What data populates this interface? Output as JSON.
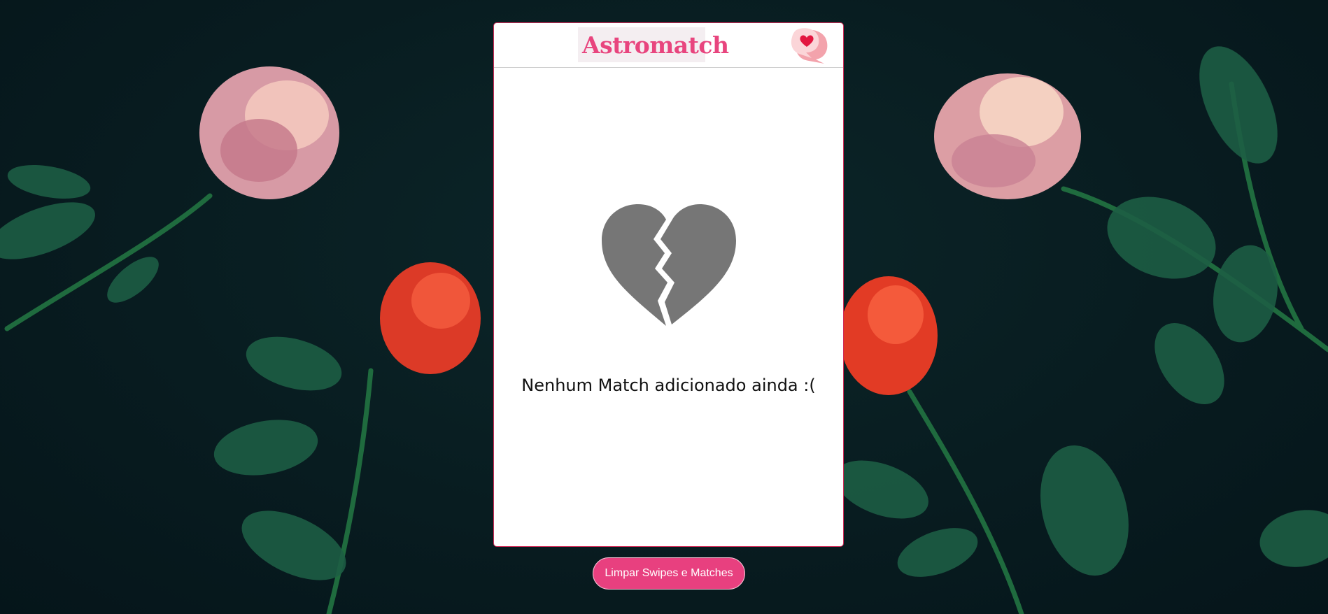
{
  "app": {
    "logo_text": "Astromatch",
    "logo_icon": "heart-icon",
    "matches_icon": "chat-heart-icon"
  },
  "matches": {
    "empty_icon": "broken-heart-icon",
    "empty_message": "Nenhum Match adicionado ainda :("
  },
  "actions": {
    "clear_label": "Limpar Swipes e Matches"
  },
  "colors": {
    "brand_pink": "#e8407f",
    "card_border": "#d02b57",
    "broken_heart": "#767676",
    "background": "#081c20"
  }
}
